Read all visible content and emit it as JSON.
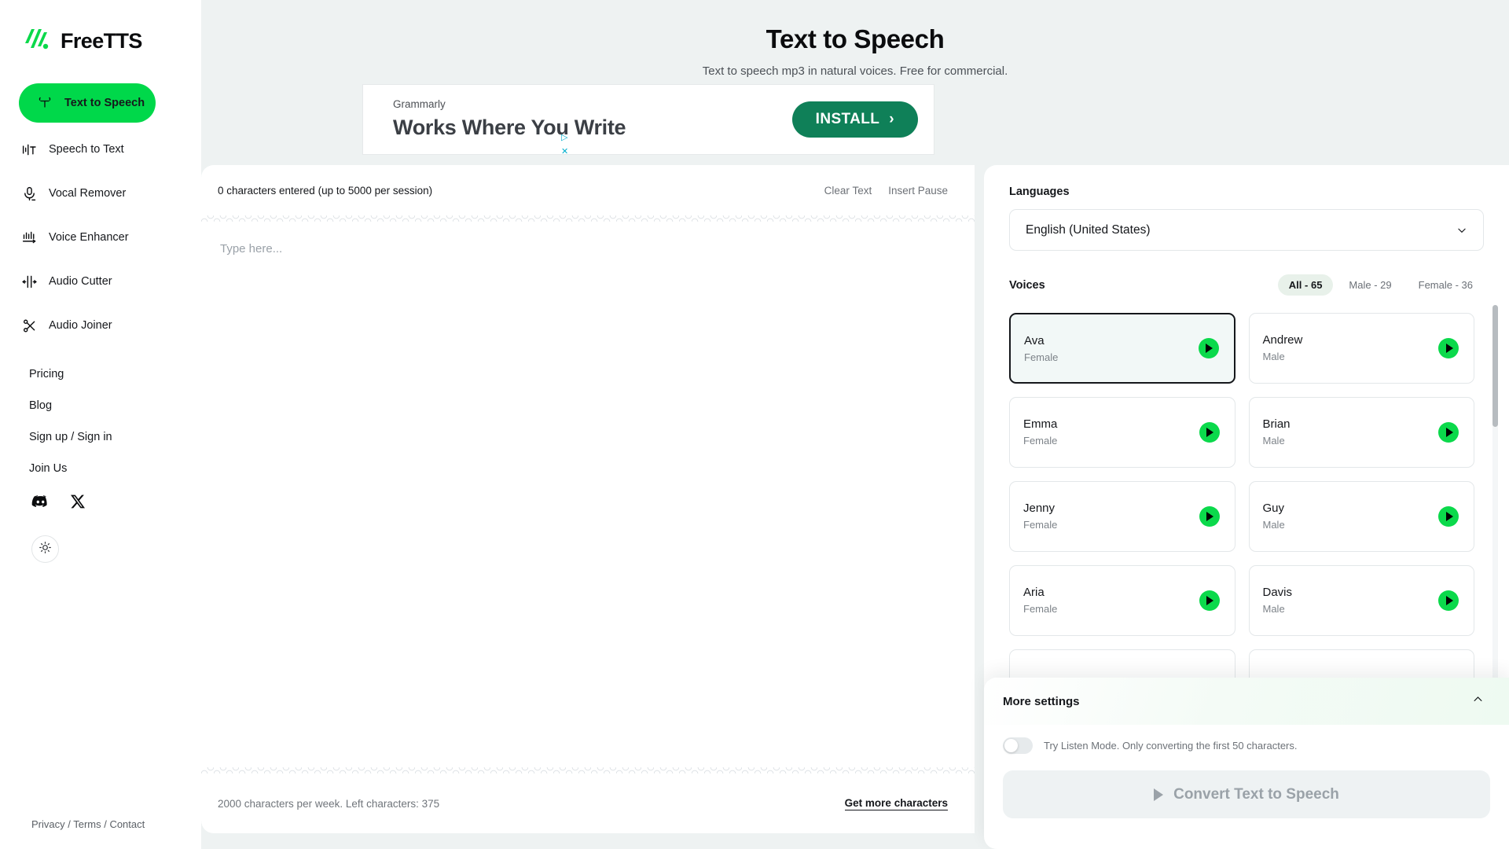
{
  "brand": {
    "name": "FreeTTS",
    "logo_icon": "freetts-logo-icon"
  },
  "sidebar": {
    "nav": [
      {
        "label": "Text to Speech",
        "icon": "text-to-speech-icon",
        "active": true
      },
      {
        "label": "Speech to Text",
        "icon": "speech-to-text-icon",
        "active": false
      },
      {
        "label": "Vocal Remover",
        "icon": "microphone-icon",
        "active": false
      },
      {
        "label": "Voice Enhancer",
        "icon": "voice-enhancer-icon",
        "active": false
      },
      {
        "label": "Audio Cutter",
        "icon": "audio-cutter-icon",
        "active": false
      },
      {
        "label": "Audio Joiner",
        "icon": "scissors-icon",
        "active": false
      }
    ],
    "links": [
      "Pricing",
      "Blog",
      "Sign up / Sign in",
      "Join Us"
    ],
    "social": [
      "discord-icon",
      "x-twitter-icon"
    ],
    "theme_toggle_icon": "sun-icon",
    "footer": "Privacy / Terms / Contact"
  },
  "header": {
    "title": "Text to Speech",
    "subtitle": "Text to speech mp3 in natural voices. Free for commercial."
  },
  "ad": {
    "brand": "Grammarly",
    "headline": "Works Where You Write",
    "cta": "INSTALL",
    "cta_arrow": "›",
    "adchoices_icon": "adchoices-icon",
    "close_icon": "close-icon"
  },
  "editor": {
    "char_count": "0 characters entered (up to 5000 per session)",
    "clear_text": "Clear Text",
    "insert_pause": "Insert Pause",
    "placeholder": "Type here...",
    "value": "",
    "quota_note": "2000 characters per week. Left characters: 375",
    "get_more": "Get more characters"
  },
  "panel": {
    "languages_label": "Languages",
    "language_selected": "English (United States)",
    "voices_label": "Voices",
    "filters": [
      {
        "label": "All - 65",
        "active": true
      },
      {
        "label": "Male - 29",
        "active": false
      },
      {
        "label": "Female - 36",
        "active": false
      }
    ],
    "voices": [
      {
        "name": "Ava",
        "gender": "Female",
        "selected": true
      },
      {
        "name": "Andrew",
        "gender": "Male",
        "selected": false
      },
      {
        "name": "Emma",
        "gender": "Female",
        "selected": false
      },
      {
        "name": "Brian",
        "gender": "Male",
        "selected": false
      },
      {
        "name": "Jenny",
        "gender": "Female",
        "selected": false
      },
      {
        "name": "Guy",
        "gender": "Male",
        "selected": false
      },
      {
        "name": "Aria",
        "gender": "Female",
        "selected": false
      },
      {
        "name": "Davis",
        "gender": "Male",
        "selected": false
      }
    ]
  },
  "more_settings": {
    "title": "More settings",
    "collapse_icon": "chevron-up-icon",
    "listen_mode_label": "Try Listen Mode. Only converting the first 50 characters.",
    "listen_mode_on": false,
    "convert_label": "Convert Text to Speech"
  },
  "colors": {
    "accent_green": "#00d84a",
    "play_green": "#0bd94b",
    "page_bg": "#eef2f2",
    "ad_green": "#0f8058"
  }
}
